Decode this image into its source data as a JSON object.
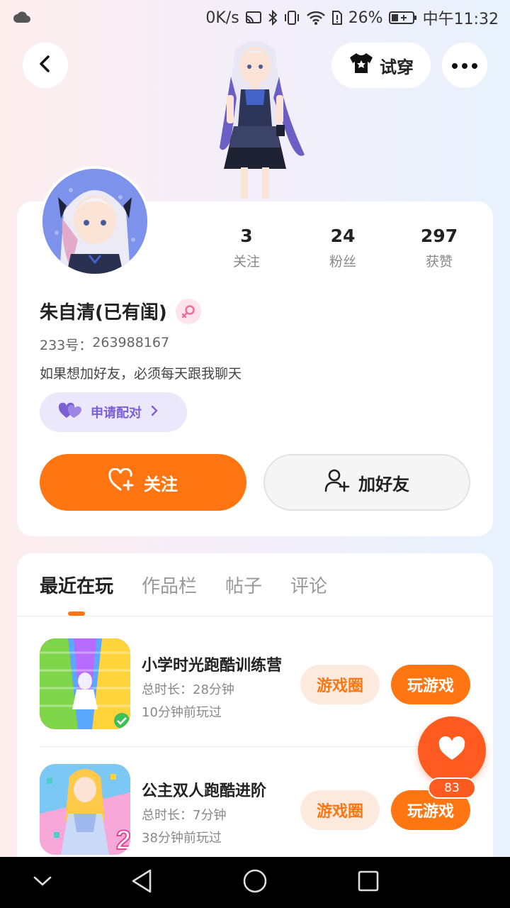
{
  "status_bar": {
    "speed": "0K/s",
    "battery_percent": "26%",
    "time": "中午11:32",
    "icons": [
      "cloud-icon",
      "cast-icon",
      "bluetooth-icon",
      "vibrate-icon",
      "wifi-icon",
      "sim-alert-icon",
      "battery-icon"
    ]
  },
  "header": {
    "try_on_label": "试穿",
    "icons": [
      "back-arrow-icon",
      "shirt-icon",
      "more-dots-icon"
    ]
  },
  "profile": {
    "stats": [
      {
        "value": "3",
        "label": "关注"
      },
      {
        "value": "24",
        "label": "粉丝"
      },
      {
        "value": "297",
        "label": "获赞"
      }
    ],
    "username": "朱自清(已有闺)",
    "uid_label": "233号：",
    "uid_value": "263988167",
    "bio": "如果想加好友，必须每天跟我聊天",
    "pair_label": "申请配对",
    "follow_label": "关注",
    "add_friend_label": "加好友"
  },
  "tabs": [
    {
      "label": "最近在玩",
      "active": true
    },
    {
      "label": "作品栏",
      "active": false
    },
    {
      "label": "帖子",
      "active": false
    },
    {
      "label": "评论",
      "active": false
    }
  ],
  "games": [
    {
      "title": "小学时光跑酷训练营",
      "duration_label": "总时长：",
      "duration_value": "28分钟",
      "last_played": "10分钟前玩过",
      "circle_label": "游戏圈",
      "play_label": "玩游戏"
    },
    {
      "title": "公主双人跑酷进阶",
      "duration_label": "总时长：",
      "duration_value": "7分钟",
      "last_played": "38分钟前玩过",
      "circle_label": "游戏圈",
      "play_label": "玩游戏"
    }
  ],
  "like_fab": {
    "count": "83"
  },
  "colors": {
    "accent": "#ff7512",
    "pair_purple": "#7a5fd6",
    "like_red": "#ff5a1f"
  }
}
